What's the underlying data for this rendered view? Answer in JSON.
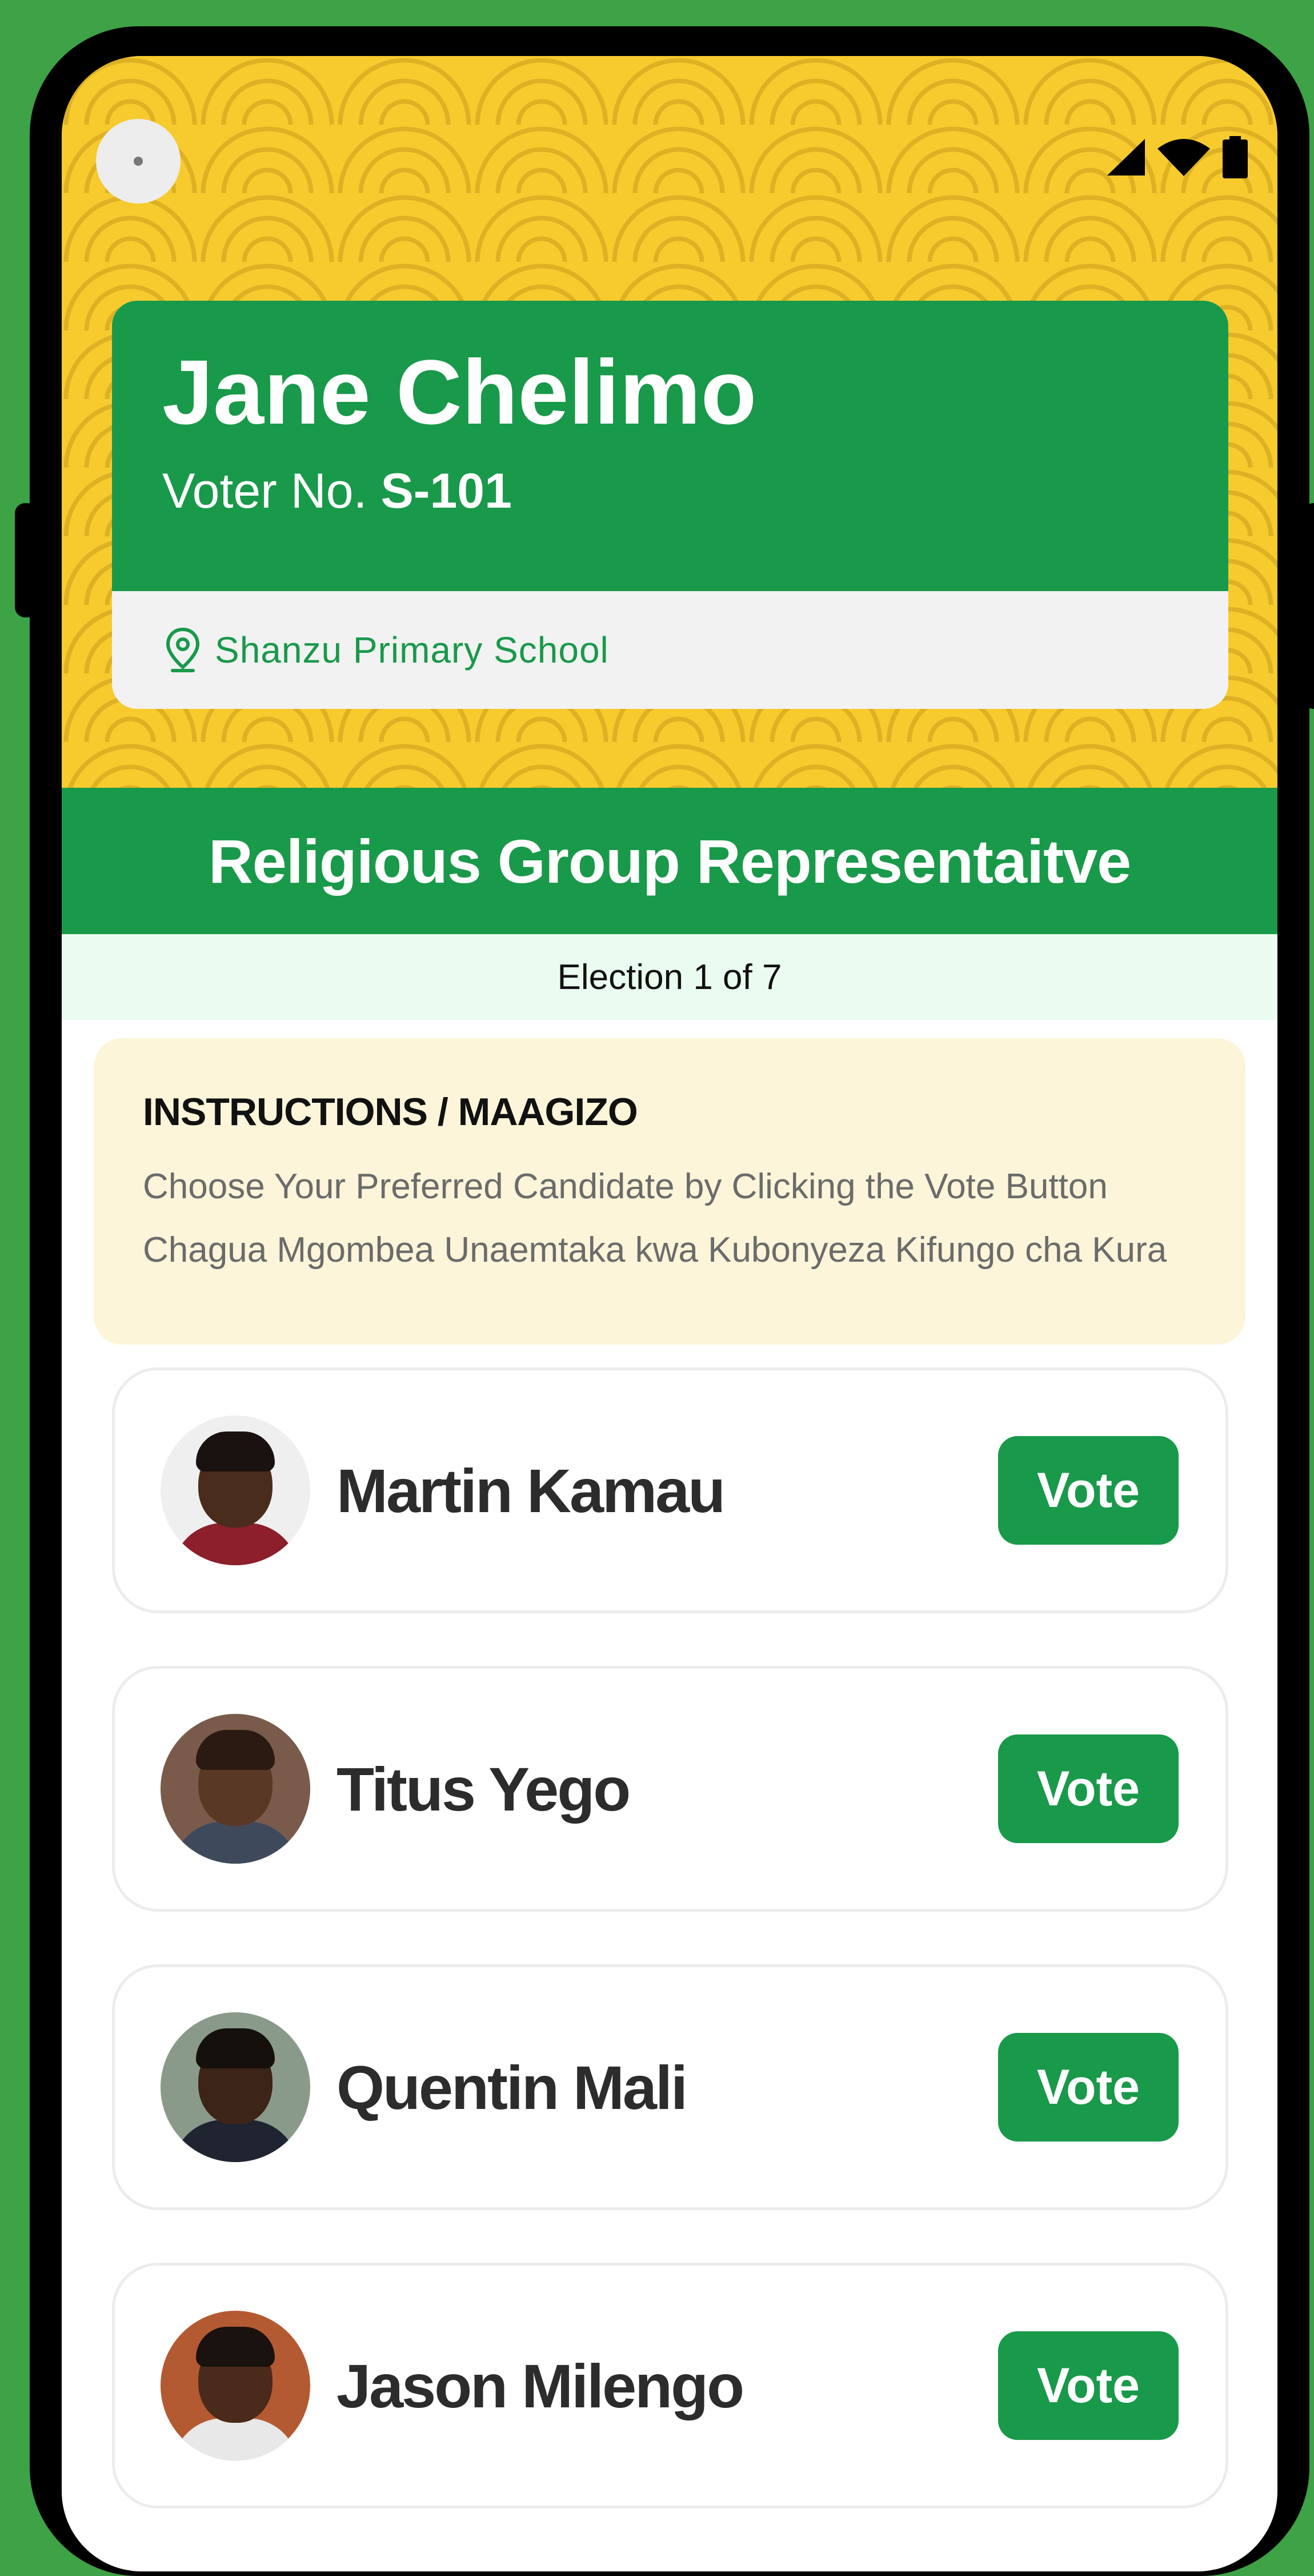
{
  "status_bar": {
    "icons": [
      "signal-icon",
      "wifi-icon",
      "battery-icon"
    ]
  },
  "voter": {
    "name": "Jane Chelimo",
    "number_label": "Voter No. ",
    "number": "S-101",
    "polling_station": "Shanzu Primary School",
    "location_icon": "map-pin-icon"
  },
  "election": {
    "title": "Religious Group Representaitve",
    "progress_text": "Election 1 of 7"
  },
  "instructions": {
    "title": "INSTRUCTIONS / MAAGIZO",
    "english": "Choose Your Preferred Candidate by Clicking the Vote Button",
    "swahili": "Chagua Mgombea Unaemtaka kwa Kubonyeza Kifungo cha Kura"
  },
  "candidates": [
    {
      "name": "Martin Kamau",
      "vote_label": "Vote"
    },
    {
      "name": "Titus Yego",
      "vote_label": "Vote"
    },
    {
      "name": "Quentin Mali",
      "vote_label": "Vote"
    },
    {
      "name": "Jason Milengo",
      "vote_label": "Vote"
    }
  ],
  "colors": {
    "primary_green": "#19994a",
    "header_yellow": "#f7cb2e",
    "instruction_bg": "#fdf5d9",
    "progress_bg": "#eafcf0",
    "background_green": "#3ea246"
  }
}
